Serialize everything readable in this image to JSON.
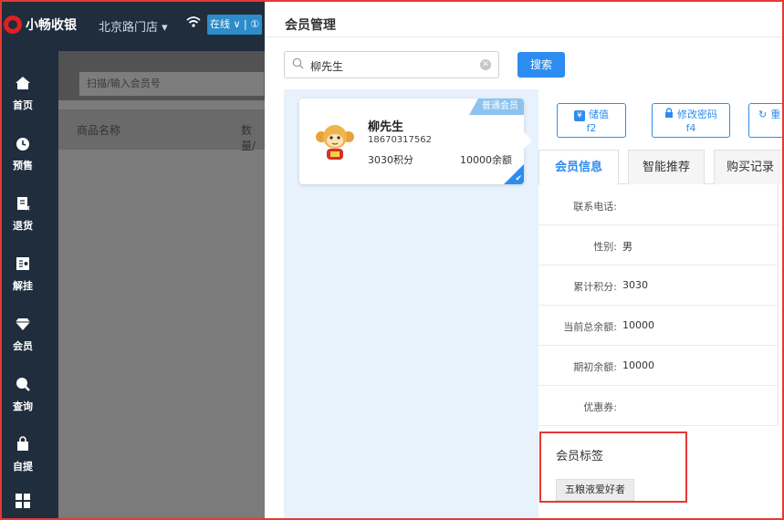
{
  "app": {
    "brand": "小畅收银",
    "store": "北京路门店 ▾",
    "status": "在线 ∨ | ①"
  },
  "sidebar": {
    "items": [
      {
        "label": "首页",
        "icon": "home-icon"
      },
      {
        "label": "预售",
        "icon": "clock-icon"
      },
      {
        "label": "退货",
        "icon": "return-icon"
      },
      {
        "label": "解挂",
        "icon": "unhold-icon"
      },
      {
        "label": "会员",
        "icon": "diamond-icon"
      },
      {
        "label": "查询",
        "icon": "search-icon"
      },
      {
        "label": "自提",
        "icon": "bag-icon"
      },
      {
        "label": "",
        "icon": "grid-icon"
      }
    ]
  },
  "main": {
    "scan_placeholder": "扫描/输入会员号",
    "columns": [
      "商品名称",
      "数量/"
    ]
  },
  "panel": {
    "title": "会员管理",
    "search_value": "柳先生",
    "search_button": "搜索",
    "member": {
      "badge": "普通会员",
      "name": "柳先生",
      "phone": "18670317562",
      "points": "3030积分",
      "balance": "10000余额"
    },
    "actions": [
      {
        "label": "储值",
        "key": "f2",
        "icon": "yen-icon"
      },
      {
        "label": "修改密码",
        "key": "f4",
        "icon": "lock-icon"
      },
      {
        "label": "重",
        "key": "",
        "icon": "refresh-icon"
      }
    ],
    "tabs": [
      "会员信息",
      "智能推荐",
      "购买记录"
    ],
    "info": [
      {
        "label": "联系电话:",
        "value": ""
      },
      {
        "label": "性别:",
        "value": "男"
      },
      {
        "label": "累计积分:",
        "value": "3030"
      },
      {
        "label": "当前总余额:",
        "value": "10000"
      },
      {
        "label": "期初余额:",
        "value": "10000"
      },
      {
        "label": "优惠券:",
        "value": ""
      }
    ],
    "tags_title": "会员标签",
    "tags": [
      "五粮液爱好者"
    ]
  },
  "colors": {
    "accent": "#2d8cf0",
    "highlight": "#e53935",
    "sidebar_bg": "#1f2d3d"
  }
}
